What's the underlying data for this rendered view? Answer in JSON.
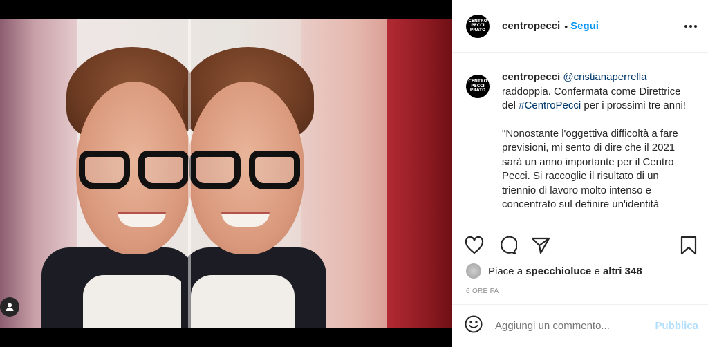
{
  "header": {
    "avatar_text": "CENTRO PECCI PRATO",
    "username": "centropecci",
    "separator": "•",
    "follow_label": "Segui"
  },
  "caption": {
    "username": "centropecci",
    "mention": "@cristianaperrella",
    "text_1": " raddoppia. Confermata come Direttrice del ",
    "hashtag": "#CentroPecci",
    "text_2": " per i prossimi tre anni!",
    "paragraph_2": "\"Nonostante l'oggettiva difficoltà a fare previsioni, mi sento di dire che il 2021 sarà un anno importante per il Centro Pecci. Si raccoglie il risultato di un triennio di lavoro molto intenso e concentrato sul definire un'identità"
  },
  "likes": {
    "prefix": "Piace a ",
    "user": "specchioluce",
    "connector": " e ",
    "others": "altri 348"
  },
  "timestamp": "6 ORE FA",
  "comment": {
    "placeholder": "Aggiungi un commento...",
    "publish_label": "Pubblica"
  },
  "icons": {
    "like": "heart-icon",
    "comment": "comment-icon",
    "share": "share-icon",
    "save": "bookmark-icon",
    "emoji": "emoji-icon",
    "more": "more-icon",
    "user_tag": "user-tag-icon"
  },
  "colors": {
    "link_blue": "#0095f6",
    "publish_disabled": "#b2dffc",
    "muted": "#8e8e8e"
  }
}
